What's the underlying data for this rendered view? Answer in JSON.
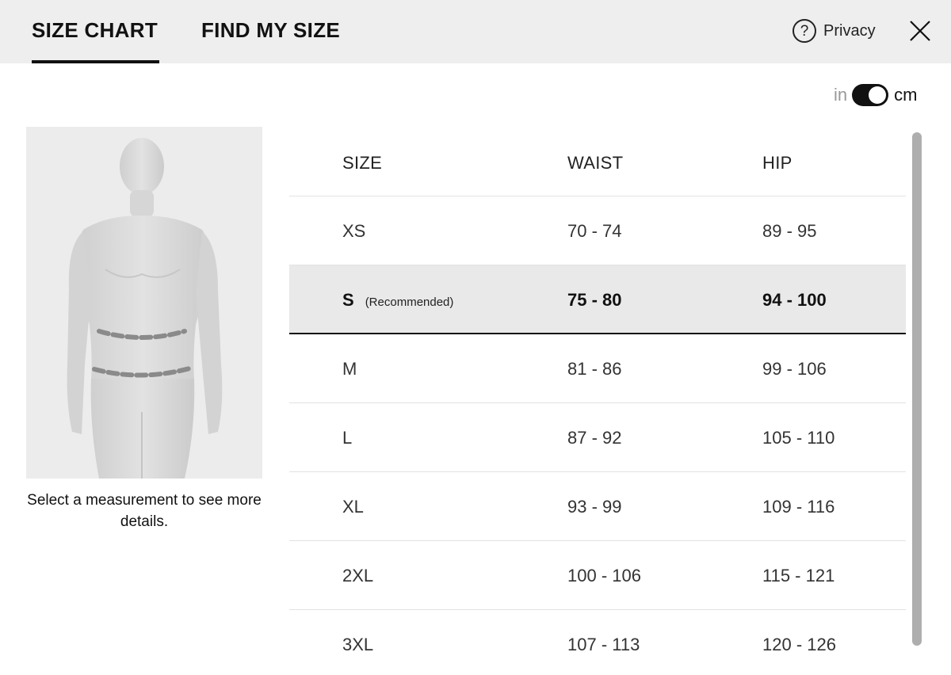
{
  "header": {
    "tabs": [
      {
        "label": "SIZE CHART",
        "active": true
      },
      {
        "label": "FIND MY SIZE",
        "active": false
      }
    ],
    "privacy_label": "Privacy",
    "help_icon": "question-circle-icon",
    "close_icon": "close-icon"
  },
  "units": {
    "left": "in",
    "right": "cm",
    "selected": "cm"
  },
  "figure": {
    "caption": "Select a measurement to see more details."
  },
  "table": {
    "headers": {
      "size": "SIZE",
      "waist": "WAIST",
      "hip": "HIP"
    },
    "rows": [
      {
        "size": "XS",
        "waist": "70 - 74",
        "hip": "89 - 95"
      },
      {
        "size": "S",
        "note": "(Recommended)",
        "waist": "75 - 80",
        "hip": "94 - 100"
      },
      {
        "size": "M",
        "waist": "81 - 86",
        "hip": "99 - 106"
      },
      {
        "size": "L",
        "waist": "87 - 92",
        "hip": "105 - 110"
      },
      {
        "size": "XL",
        "waist": "93 - 99",
        "hip": "109 - 116"
      },
      {
        "size": "2XL",
        "waist": "100 - 106",
        "hip": "115 - 121"
      },
      {
        "size": "3XL",
        "waist": "107 - 113",
        "hip": "120 - 126"
      }
    ]
  },
  "colors": {
    "header_bg": "#eeeeee",
    "highlight_row": "#e9e9e9",
    "text": "#111111",
    "muted": "#999999"
  }
}
